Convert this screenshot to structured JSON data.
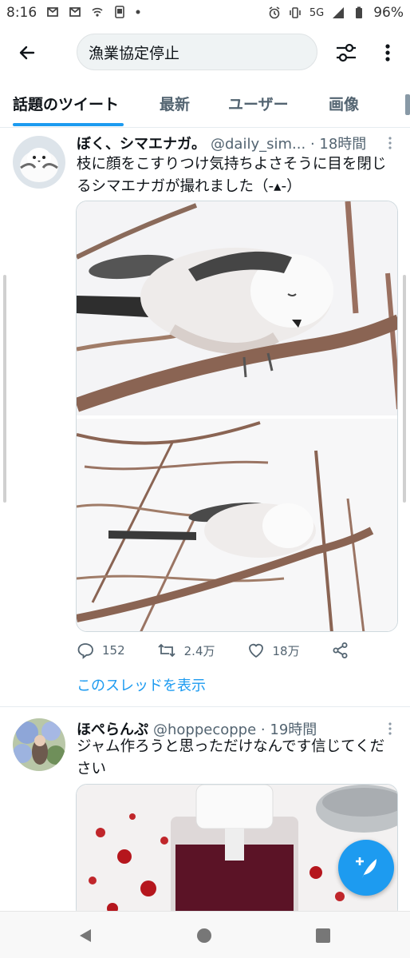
{
  "status_bar": {
    "time": "8:16",
    "network": "5G",
    "battery": "96%",
    "icons": [
      "mail-icon",
      "mail-icon",
      "wifi-calling-icon",
      "screenshot-icon",
      "dot-icon",
      "alarm-icon",
      "vibrate-icon",
      "signal-icon",
      "battery-icon"
    ]
  },
  "search": {
    "query": "漁業協定停止"
  },
  "tabs": [
    {
      "label": "話題のツイート",
      "active": true
    },
    {
      "label": "最新",
      "active": false
    },
    {
      "label": "ユーザー",
      "active": false
    },
    {
      "label": "画像",
      "active": false
    }
  ],
  "tweets": [
    {
      "name": "ぼく、シマエナガ。",
      "handle": "@daily_sim...",
      "time": "· 18時間",
      "text": "枝に顔をこすりつけ気持ちよさそうに目を閉じるシマエナガが撮れました（-▴-）",
      "replies": "152",
      "retweets": "2.4万",
      "likes": "18万",
      "thread_link": "このスレッドを表示"
    },
    {
      "name": "ほぺらんぷ",
      "handle": "@hoppecoppe",
      "time": "· 19時間",
      "text": "ジャム作ろうと思っただけなんです信じてください"
    }
  ],
  "colors": {
    "accent": "#1d9bf0",
    "text_primary": "#0f1419",
    "text_secondary": "#536471",
    "divider": "#e6ecf0"
  }
}
